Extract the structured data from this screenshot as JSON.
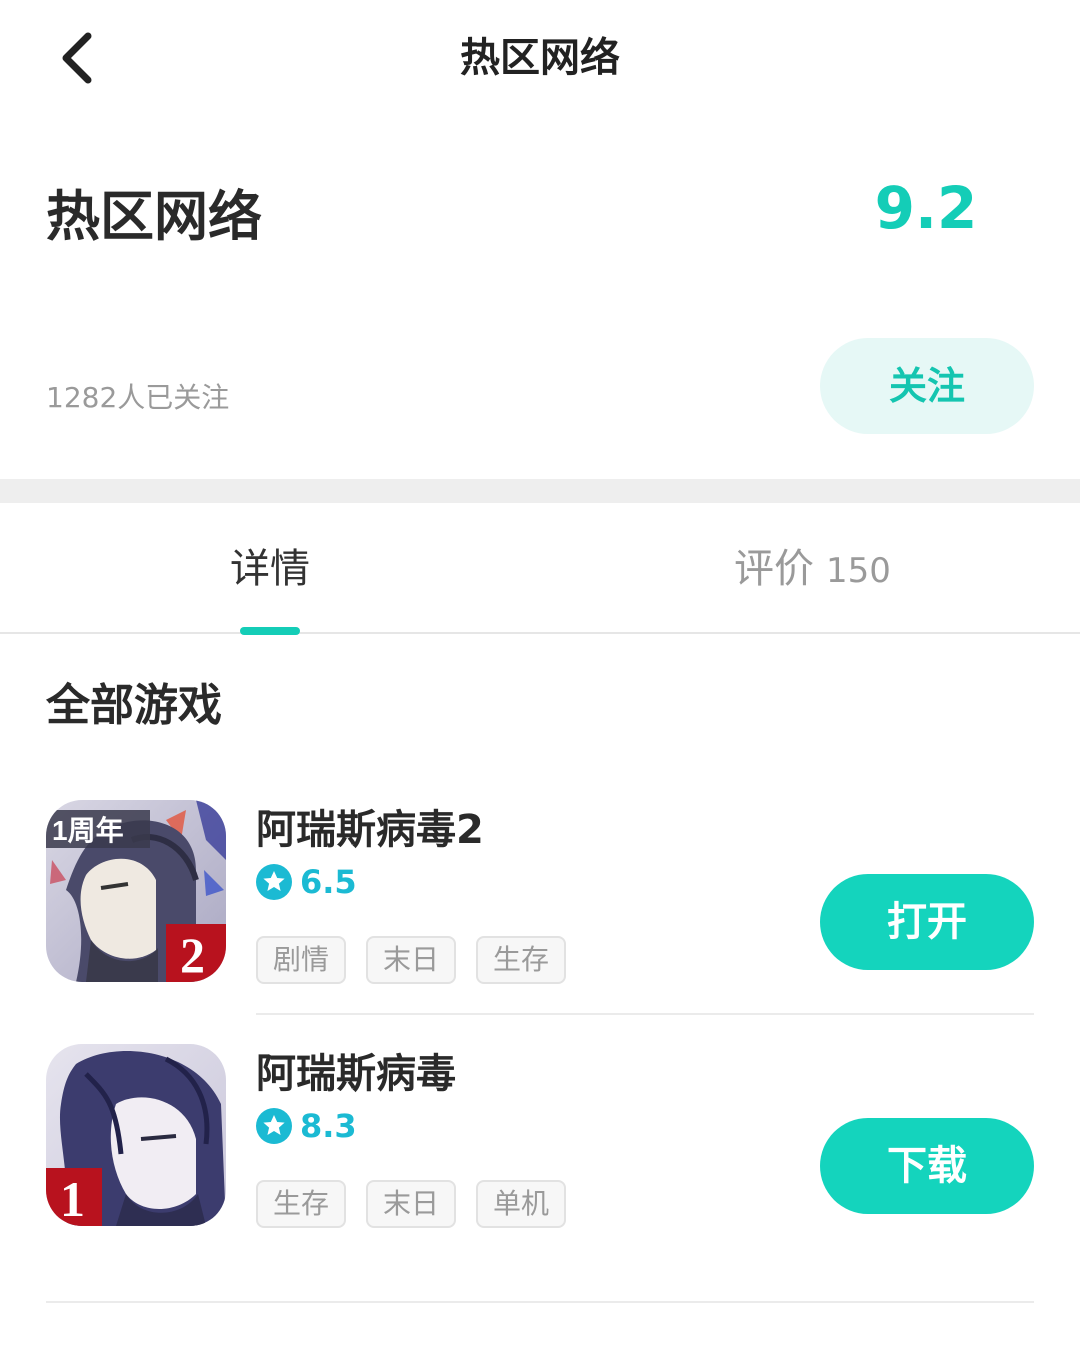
{
  "nav": {
    "title": "热区网络",
    "back_icon": "chevron-left-icon"
  },
  "developer": {
    "name": "热区网络",
    "score": "9.2",
    "followers": "1282人已关注",
    "follow_label": "关注"
  },
  "tabs": [
    {
      "label": "详情",
      "count": "",
      "active": true
    },
    {
      "label": "评价",
      "count": "150",
      "active": false
    }
  ],
  "section": {
    "title": "全部游戏"
  },
  "games": [
    {
      "name": "阿瑞斯病毒2",
      "rating": "6.5",
      "tags": [
        "剧情",
        "末日",
        "生存"
      ],
      "action": "打开",
      "icon_badge": "2",
      "icon_banner": "1周年"
    },
    {
      "name": "阿瑞斯病毒",
      "rating": "8.3",
      "tags": [
        "生存",
        "末日",
        "单机"
      ],
      "action": "下载",
      "icon_badge": "1"
    }
  ],
  "colors": {
    "accent": "#14d4bd",
    "score": "#14cdb7",
    "rating": "#1bbad3",
    "follow_bg": "#e6f8f6"
  }
}
